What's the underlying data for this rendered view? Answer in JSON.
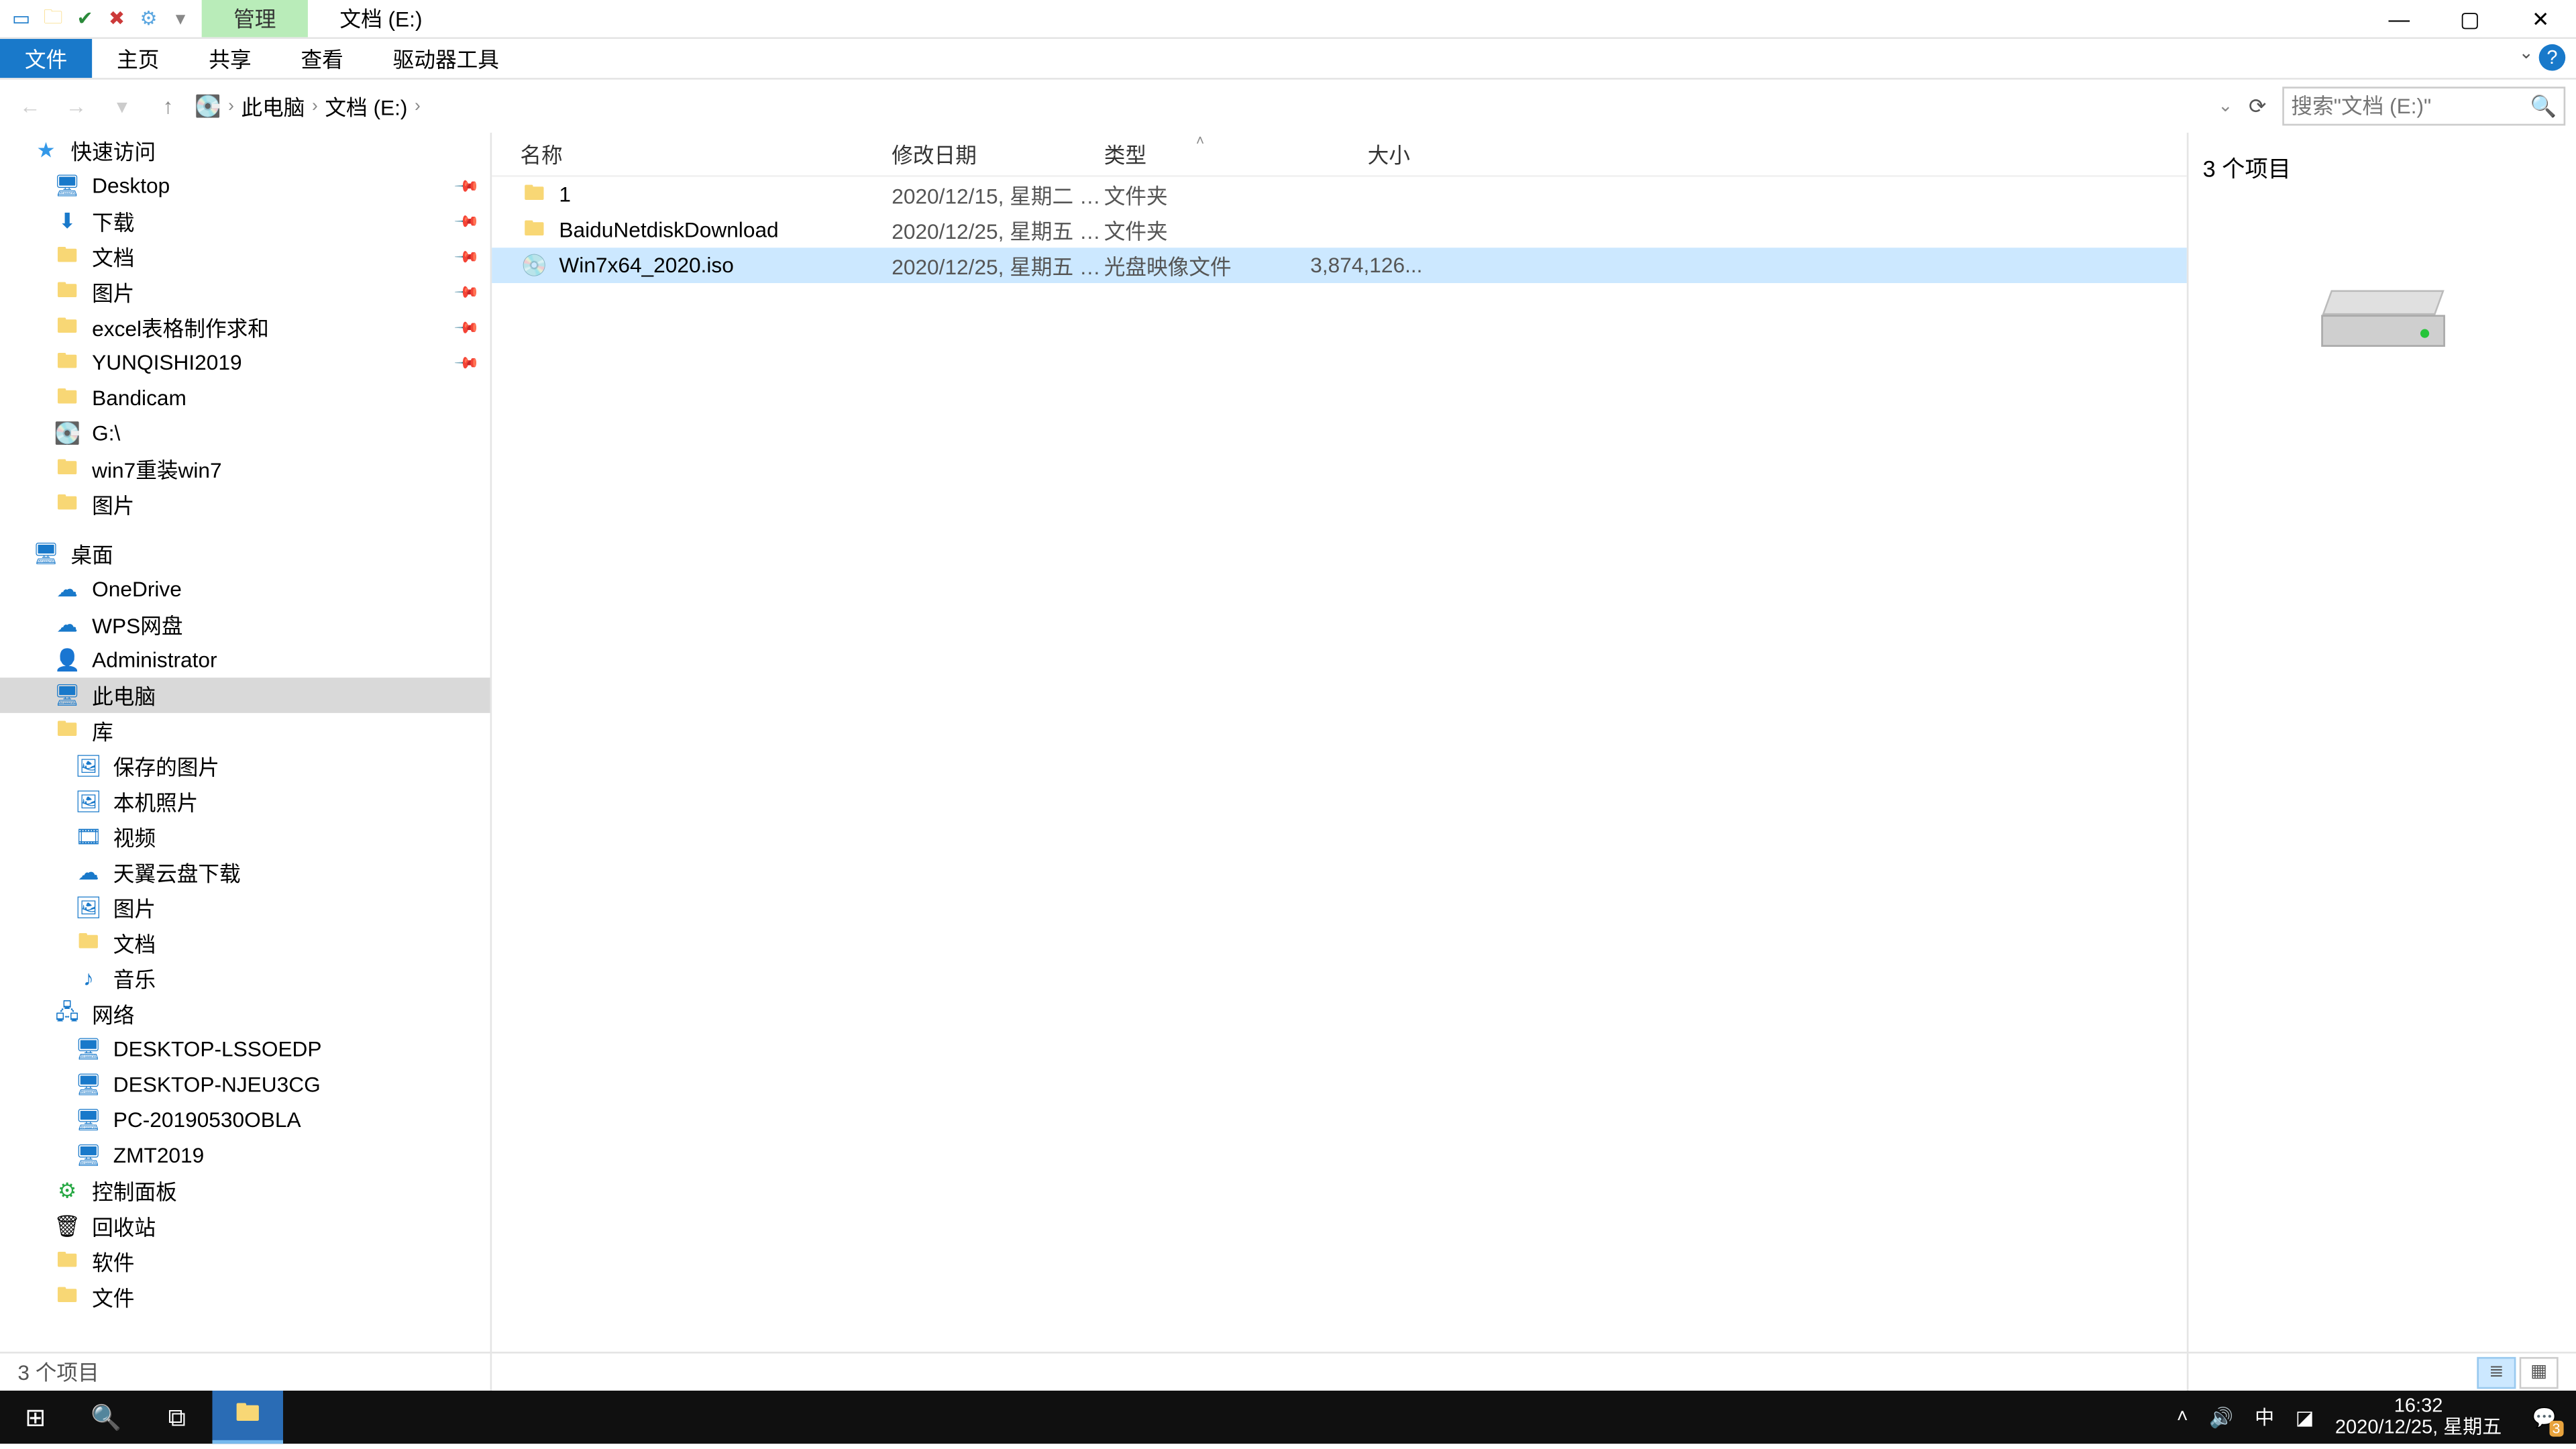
{
  "title": {
    "tab_manage": "管理",
    "tab_location": "文档 (E:)"
  },
  "ribbon": {
    "file": "文件",
    "home": "主页",
    "share": "共享",
    "view": "查看",
    "drive_tools": "驱动器工具"
  },
  "address": {
    "root": "此电脑",
    "drive": "文档 (E:)"
  },
  "search": {
    "placeholder": "搜索\"文档 (E:)\""
  },
  "nav": {
    "quick_access": "快速访问",
    "desktop": "Desktop",
    "downloads": "下载",
    "documents": "文档",
    "pictures": "图片",
    "excel": "excel表格制作求和",
    "yunqishi": "YUNQISHI2019",
    "bandicam": "Bandicam",
    "gdrive": "G:\\",
    "win7reload": "win7重装win7",
    "pictures2": "图片",
    "desktop2": "桌面",
    "onedrive": "OneDrive",
    "wps": "WPS网盘",
    "admin": "Administrator",
    "thispc": "此电脑",
    "library": "库",
    "saved_pics": "保存的图片",
    "camera_roll": "本机照片",
    "videos": "视频",
    "tianyi": "天翼云盘下载",
    "pictures3": "图片",
    "documents3": "文档",
    "music": "音乐",
    "network": "网络",
    "pc1": "DESKTOP-LSSOEDP",
    "pc2": "DESKTOP-NJEU3CG",
    "pc3": "PC-20190530OBLA",
    "pc4": "ZMT2019",
    "controlpanel": "控制面板",
    "recycle": "回收站",
    "software": "软件",
    "files": "文件"
  },
  "columns": {
    "name": "名称",
    "date": "修改日期",
    "type": "类型",
    "size": "大小"
  },
  "files": [
    {
      "name": "1",
      "date": "2020/12/15, 星期二 1...",
      "type": "文件夹",
      "size": ""
    },
    {
      "name": "BaiduNetdiskDownload",
      "date": "2020/12/25, 星期五 1...",
      "type": "文件夹",
      "size": ""
    },
    {
      "name": "Win7x64_2020.iso",
      "date": "2020/12/25, 星期五 1...",
      "type": "光盘映像文件",
      "size": "3,874,126..."
    }
  ],
  "preview": {
    "count": "3 个项目"
  },
  "statusbar": {
    "text": "3 个项目"
  },
  "taskbar": {
    "ime": "中",
    "time": "16:32",
    "date": "2020/12/25, 星期五",
    "notif_count": "3"
  }
}
